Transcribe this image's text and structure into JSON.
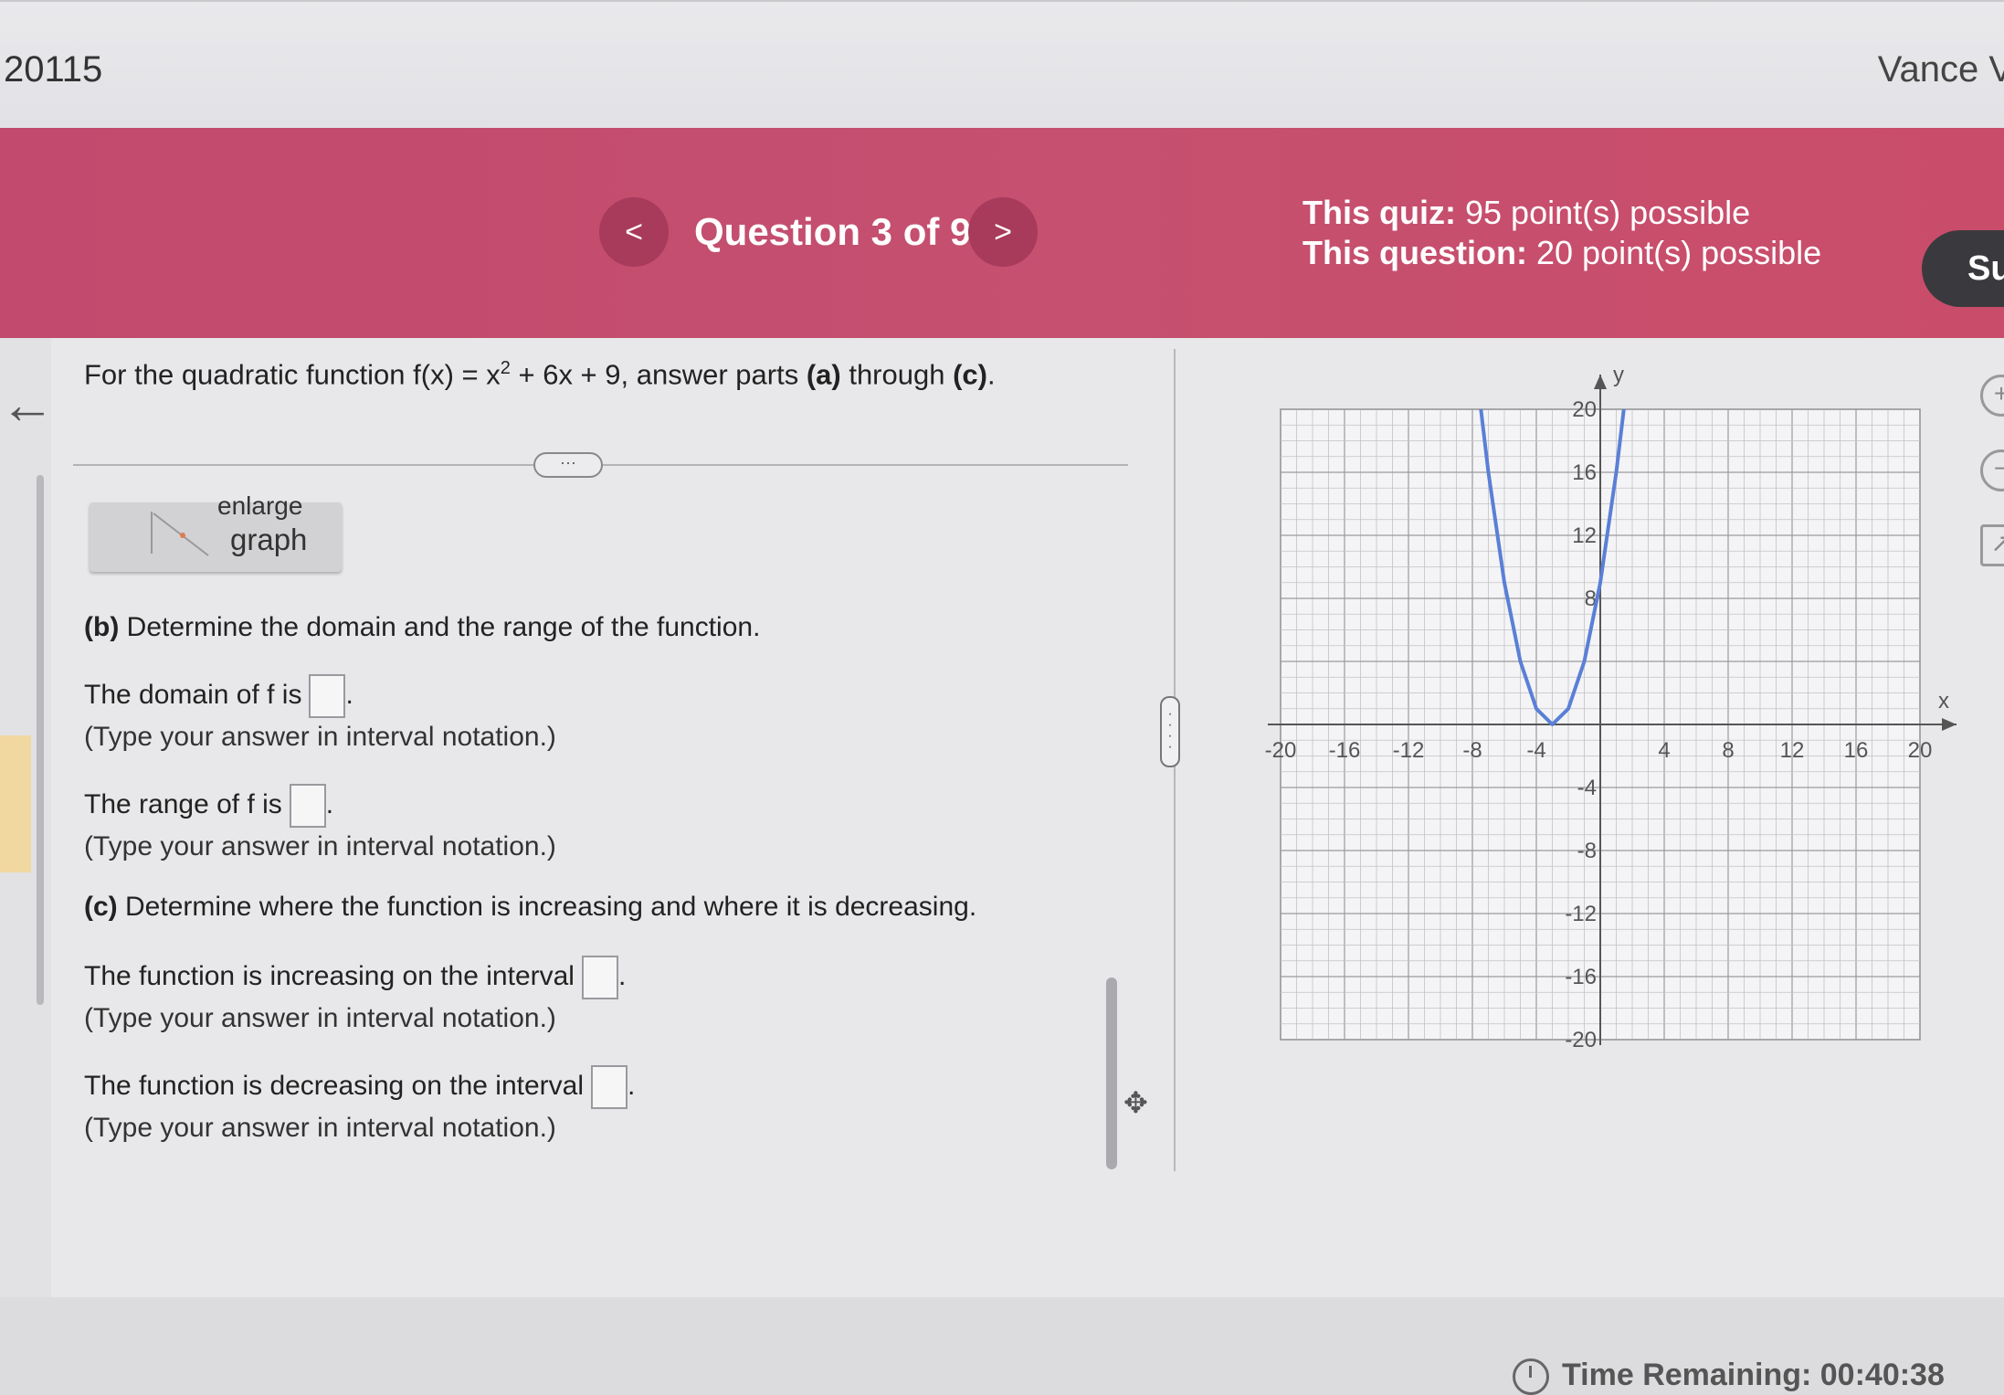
{
  "header": {
    "course_id": "20115",
    "user_name": "Vance V"
  },
  "banner": {
    "prev_icon": "<",
    "next_icon": ">",
    "question_label": "Question 3 of 9",
    "quiz_points_label": "This quiz:",
    "quiz_points_value": "95 point(s) possible",
    "question_points_label": "This question:",
    "question_points_value": "20 point(s) possible",
    "submit_label": "Su"
  },
  "problem": {
    "prefix": "For the quadratic function f(x) = x",
    "exponent": "2",
    "suffix_1": " + 6x + 9, answer parts ",
    "part_a": "(a)",
    "mid": " through ",
    "part_c": "(c)",
    "end": "."
  },
  "toggle_dots": "···",
  "enlarge": {
    "top": "enlarge",
    "label": "graph"
  },
  "part_b": {
    "tag": "(b)",
    "prompt": " Determine the domain and the range of the function.",
    "domain_label": "The domain of f is",
    "range_label": "The range of f is",
    "note": "(Type your answer in interval notation.)",
    "domain_value": "",
    "range_value": ""
  },
  "part_c": {
    "tag": "(c)",
    "prompt": " Determine where the function is increasing and where it is decreasing.",
    "increasing_label": "The function is increasing on the interval",
    "decreasing_label": "The function is decreasing on the interval",
    "note": "(Type your answer in interval notation.)",
    "increasing_value": "",
    "decreasing_value": ""
  },
  "timer": {
    "label": "Time Remaining:",
    "value": "00:40:38"
  },
  "side_icons": [
    "zoom-in-icon",
    "zoom-out-icon",
    "popout-icon"
  ],
  "chart_data": {
    "type": "line",
    "xlabel": "x",
    "ylabel": "y",
    "xlim": [
      -20,
      20
    ],
    "ylim": [
      -20,
      20
    ],
    "grid": true,
    "x_ticks": [
      "-20",
      "-16",
      "-12",
      "-8",
      "-4",
      "4",
      "8",
      "12",
      "16",
      "20"
    ],
    "y_ticks": [
      "20",
      "16",
      "12",
      "8",
      "-4",
      "-8",
      "-12",
      "-16",
      "-20"
    ],
    "series": [
      {
        "color": "#5a7fd6",
        "x": [
          -7.5,
          -7,
          -6,
          -5,
          -4,
          -3,
          -2,
          -1,
          0,
          1,
          1.5
        ],
        "y": [
          20.25,
          16,
          9,
          4,
          1,
          0,
          1,
          4,
          9,
          16,
          20.25
        ]
      }
    ]
  }
}
